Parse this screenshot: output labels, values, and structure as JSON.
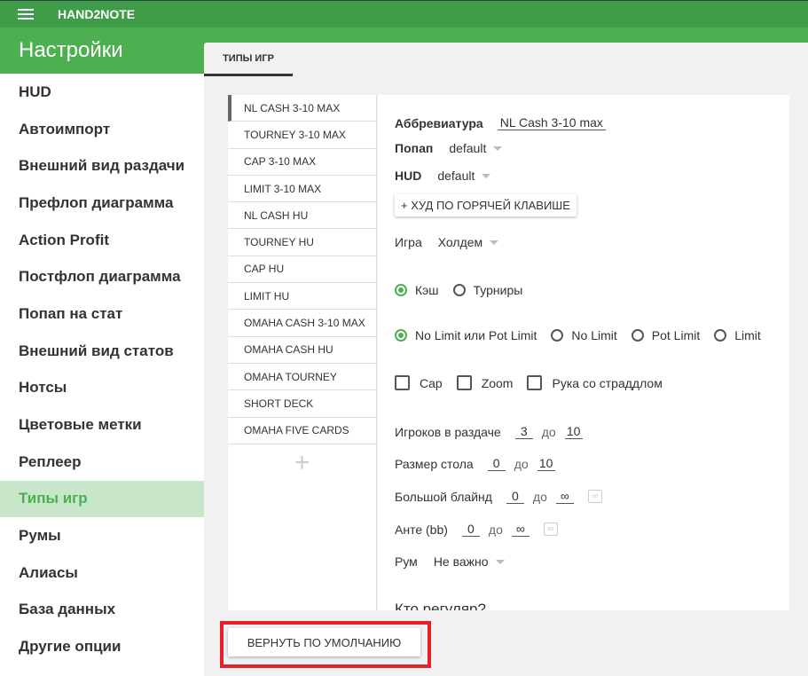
{
  "app": {
    "title": "HAND2NOTE",
    "menu_icon": "hamburger-icon"
  },
  "header": {
    "title": "Настройки"
  },
  "sidebar": {
    "items": [
      {
        "label": "HUD"
      },
      {
        "label": "Автоимпорт"
      },
      {
        "label": "Внешний вид раздачи"
      },
      {
        "label": "Префлоп диаграмма"
      },
      {
        "label": "Action Profit"
      },
      {
        "label": "Постфлоп диаграмма"
      },
      {
        "label": "Попап на стат"
      },
      {
        "label": "Внешний вид статов"
      },
      {
        "label": "Нотсы"
      },
      {
        "label": "Цветовые метки"
      },
      {
        "label": "Реплеер"
      },
      {
        "label": "Типы игр",
        "active": true
      },
      {
        "label": "Румы"
      },
      {
        "label": "Алиасы"
      },
      {
        "label": "База данных"
      },
      {
        "label": "Другие опции"
      }
    ]
  },
  "tabs": [
    {
      "label": "ТИПЫ ИГР",
      "active": true
    }
  ],
  "game_types": [
    "NL CASH 3-10 MAX",
    "TOURNEY 3-10 MAX",
    "CAP 3-10 MAX",
    "LIMIT 3-10 MAX",
    "NL CASH HU",
    "TOURNEY HU",
    "CAP HU",
    "LIMIT HU",
    "OMAHA CASH 3-10 MAX",
    "OMAHA CASH HU",
    "OMAHA TOURNEY",
    "SHORT DECK",
    "OMAHA FIVE CARDS"
  ],
  "add_label": "+",
  "form": {
    "abbr_label": "Аббревиатура",
    "abbr_value": "NL Cash 3-10 max",
    "popup_label": "Попап",
    "popup_value": "default",
    "hud_label": "HUD",
    "hud_value": "default",
    "hotkey_button": "+ ХУД ПО ГОРЯЧЕЙ КЛАВИШЕ",
    "game_label": "Игра",
    "game_value": "Холдем",
    "type_options": [
      {
        "label": "Кэш",
        "checked": true
      },
      {
        "label": "Турниры",
        "checked": false
      }
    ],
    "limit_options": [
      {
        "label": "No Limit или Pot Limit",
        "checked": true
      },
      {
        "label": "No Limit",
        "checked": false
      },
      {
        "label": "Pot Limit",
        "checked": false
      },
      {
        "label": "Limit",
        "checked": false
      }
    ],
    "checkboxes": [
      {
        "label": "Cap",
        "checked": false
      },
      {
        "label": "Zoom",
        "checked": false
      },
      {
        "label": "Рука со страддлом",
        "checked": false
      }
    ],
    "to": "до",
    "players": {
      "label": "Игроков в раздаче",
      "from": "3",
      "to": "10"
    },
    "table_size": {
      "label": "Размер стола",
      "from": "0",
      "to": "10"
    },
    "big_blind": {
      "label": "Большой блайнд",
      "from": "0",
      "to": "∞",
      "inf": "∞"
    },
    "ante": {
      "label": "Анте (bb)",
      "from": "0",
      "to": "∞",
      "inf": "∞"
    },
    "room_label": "Рум",
    "room_value": "Не важно",
    "regular_label": "Кто регуляр?"
  },
  "reset_button": "ВЕРНУТЬ ПО УМОЛЧАНИЮ",
  "colors": {
    "topbar": "#3f9c48",
    "header": "#4caf50",
    "active_bg": "#c8e6c9",
    "highlight": "#e8202a"
  }
}
